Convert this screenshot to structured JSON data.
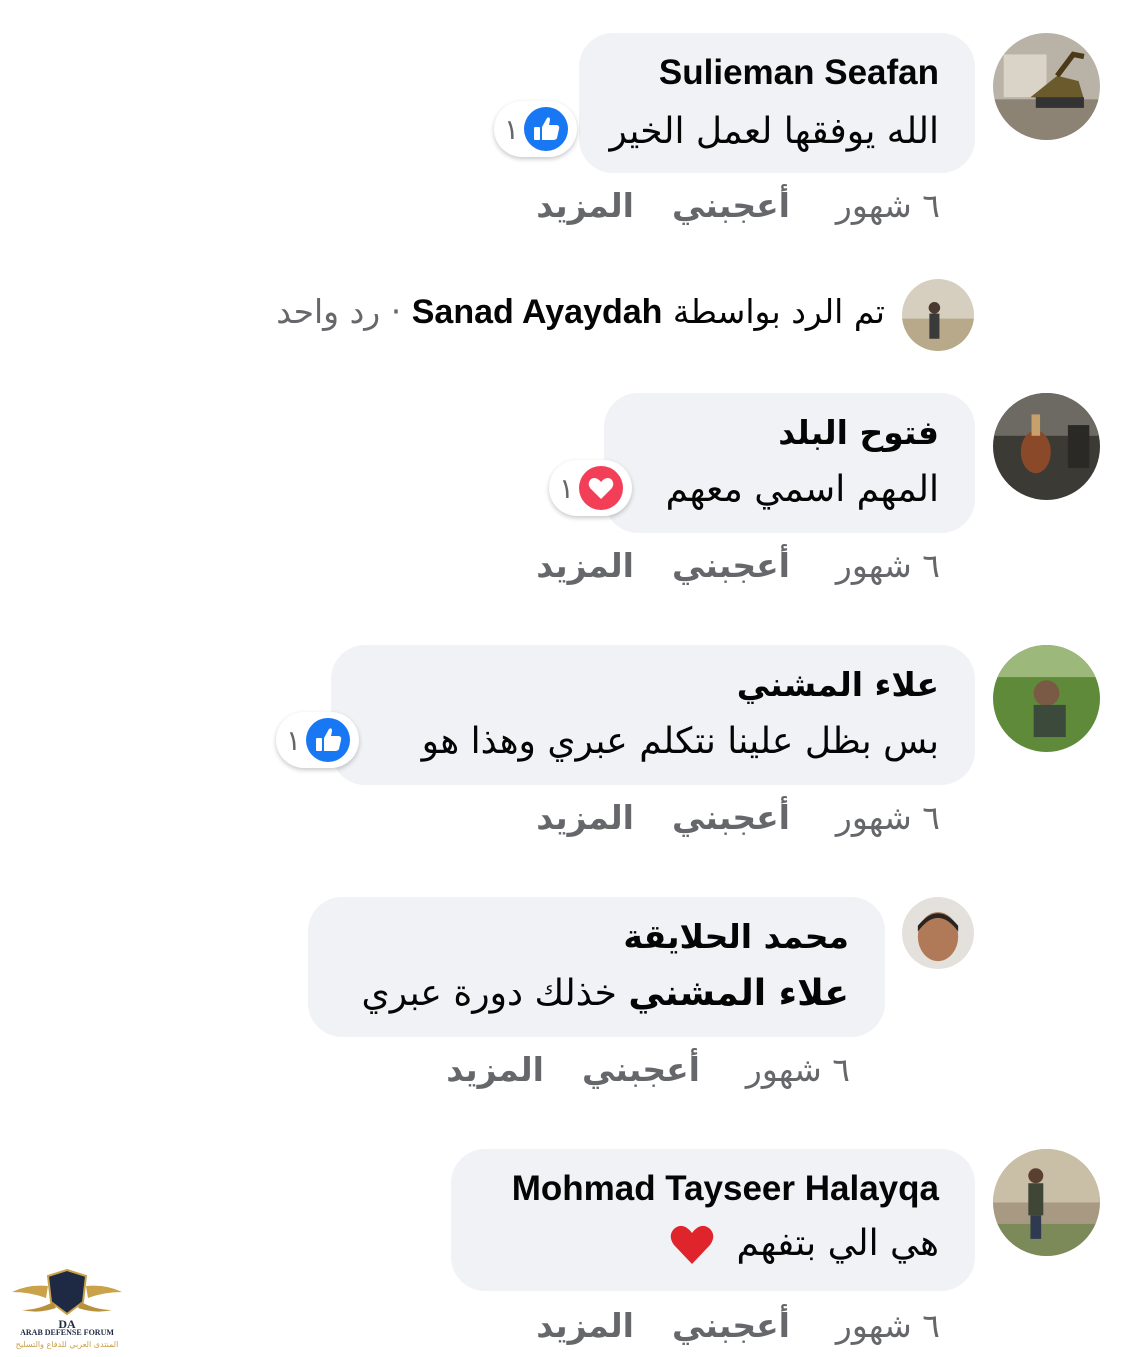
{
  "comments": [
    {
      "author": "Sulieman Seafan",
      "text": "الله يوفقها لعمل الخير",
      "reaction": {
        "type": "like-icon",
        "count": "١"
      },
      "time": "٦ شهور",
      "like_label": "أعجبني",
      "more_label": "المزيد"
    },
    {
      "author": "فتوح البلد",
      "text": "المهم اسمي معهم",
      "reaction": {
        "type": "love-icon",
        "count": "١"
      },
      "time": "٦ شهور",
      "like_label": "أعجبني",
      "more_label": "المزيد"
    },
    {
      "author": "علاء المشني",
      "text": "بس بظل علينا نتكلم عبري وهذا هو",
      "reaction": {
        "type": "like-icon",
        "count": "١"
      },
      "time": "٦ شهور",
      "like_label": "أعجبني",
      "more_label": "المزيد"
    },
    {
      "author": "محمد الحلايقة",
      "mention": "علاء المشني",
      "text": "خذلك دورة عبري",
      "time": "٦ شهور",
      "like_label": "أعجبني",
      "more_label": "المزيد"
    },
    {
      "author": "Mohmad Tayseer Halayqa",
      "text": "هي الي بتفهم",
      "emoji": "red-heart-emoji",
      "time": "٦ شهور",
      "like_label": "أعجبني",
      "more_label": "المزيد"
    }
  ],
  "reply_summary": {
    "prefix": "تم الرد بواسطة",
    "name": "Sanad Ayaydah",
    "count": "· رد واحد"
  },
  "watermark": {
    "title": "ARAB DEFENSE FORUM",
    "subtitle": "المنتدى العربي للدفاع والتسليح",
    "initials": "DA"
  },
  "colors": {
    "bubble": "#f0f2f5",
    "like_blue": "#1877f2",
    "love_red": "#f33e58",
    "muted": "#65676b"
  }
}
